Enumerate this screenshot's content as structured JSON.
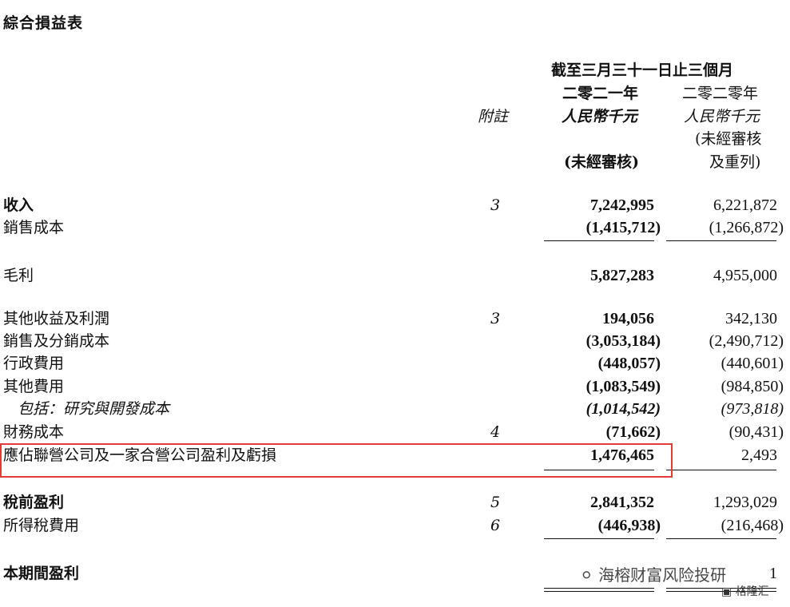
{
  "title": "綜合損益表",
  "header": {
    "period": "截至三月三十一日止三個月",
    "note_label": "附註",
    "col1_year": "二零二一年",
    "col1_unit": "人民幣千元",
    "col1_status": "(未經審核)",
    "col2_year": "二零二零年",
    "col2_unit": "人民幣千元",
    "col2_status_1": "(未經審核",
    "col2_status_2": "及重列)"
  },
  "rows": [
    {
      "label": "收入",
      "note": "3",
      "v2021": "7,242,995",
      "v2020": "6,221,872"
    },
    {
      "label": "銷售成本",
      "note": "",
      "v2021": "(1,415,712)",
      "v2020": "(1,266,872)"
    },
    {
      "label": "毛利",
      "note": "",
      "v2021": "5,827,283",
      "v2020": "4,955,000"
    },
    {
      "label": "其他收益及利潤",
      "note": "3",
      "v2021": "194,056",
      "v2020": "342,130"
    },
    {
      "label": "銷售及分銷成本",
      "note": "",
      "v2021": "(3,053,184)",
      "v2020": "(2,490,712)"
    },
    {
      "label": "行政費用",
      "note": "",
      "v2021": "(448,057)",
      "v2020": "(440,601)"
    },
    {
      "label": "其他費用",
      "note": "",
      "v2021": "(1,083,549)",
      "v2020": "(984,850)"
    },
    {
      "label": "包括：研究與開發成本",
      "note": "",
      "v2021": "(1,014,542)",
      "v2020": "(973,818)"
    },
    {
      "label": "財務成本",
      "note": "4",
      "v2021": "(71,662)",
      "v2020": "(90,431)"
    },
    {
      "label": "應佔聯營公司及一家合營公司盈利及虧損",
      "note": "",
      "v2021": "1,476,465",
      "v2020": "2,493"
    },
    {
      "label": "稅前盈利",
      "note": "5",
      "v2021": "2,841,352",
      "v2020": "1,293,029"
    },
    {
      "label": "所得稅費用",
      "note": "6",
      "v2021": "(446,938)",
      "v2020": "(216,468)"
    },
    {
      "label": "本期間盈利",
      "note": "",
      "v2021": "",
      "v2020": "1"
    }
  ],
  "watermark": {
    "text": "海榕财富风险投研",
    "sub": "格隆汇"
  }
}
